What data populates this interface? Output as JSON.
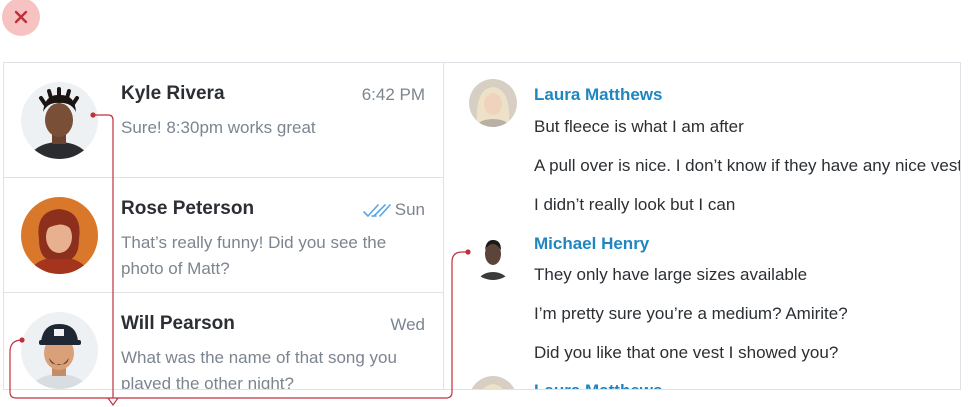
{
  "close_icon": "close-icon",
  "conversations": [
    {
      "name": "Kyle Rivera",
      "time": "6:42 PM",
      "snippet": "Sure! 8:30pm works great",
      "read": false
    },
    {
      "name": "Rose Peterson",
      "time": "Sun",
      "snippet": "That’s really funny! Did you see the photo of Matt?",
      "read": true
    },
    {
      "name": "Will Pearson",
      "time": "Wed",
      "snippet": "What was the name of that song you played the other night?",
      "read": false
    }
  ],
  "thread": {
    "groups": [
      {
        "sender": "Laura Matthews",
        "lines": [
          "But fleece is what I am after",
          "A pull over is nice. I don’t know if they have any nice vests",
          "I didn’t really look but I can"
        ]
      },
      {
        "sender": "Michael Henry",
        "lines": [
          "They only have large sizes available",
          "I’m pretty sure you’re a medium? Amirite?",
          "Did you like that one vest I showed you?"
        ]
      },
      {
        "sender": "Laura Matthews",
        "lines": []
      }
    ]
  },
  "colors": {
    "accent": "#1f86c0",
    "close_bg": "#f7c2c2",
    "close_x": "#c0303a",
    "connector": "#c0303a",
    "read_check": "#5aa6e6"
  }
}
